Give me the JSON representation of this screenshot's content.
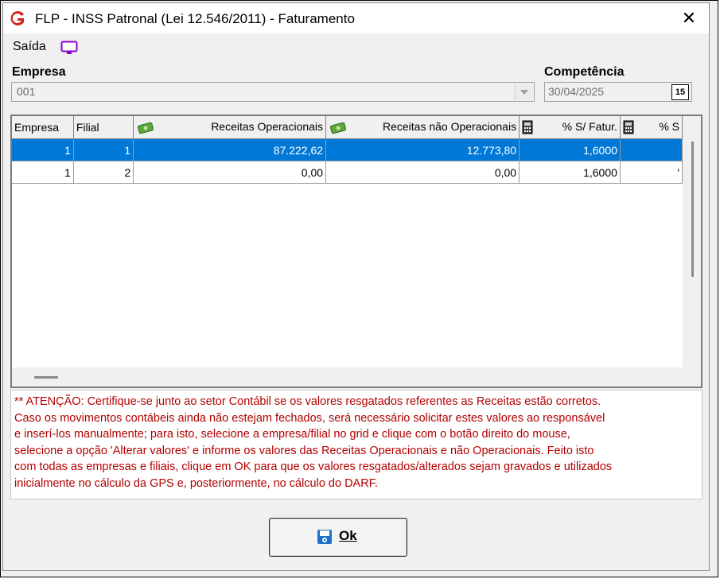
{
  "window": {
    "title": "FLP - INSS Patronal (Lei 12.546/2011) - Faturamento",
    "close_glyph": "✕"
  },
  "menu": {
    "saida_label": "Saída",
    "monitor_icon": "monitor-icon"
  },
  "empresa": {
    "label": "Empresa",
    "value": "001"
  },
  "competencia": {
    "label": "Competência",
    "value": "30/04/2025",
    "calendar_text": "15"
  },
  "grid": {
    "columns": [
      {
        "label": "Empresa",
        "icon": ""
      },
      {
        "label": "Filial",
        "icon": ""
      },
      {
        "label": "Receitas Operacionais",
        "icon": "money-icon"
      },
      {
        "label": "Receitas não Operacionais",
        "icon": "money-icon"
      },
      {
        "label": "% S/ Fatur.",
        "icon": "calculator-icon"
      },
      {
        "label": "% S",
        "icon": "calculator-icon"
      }
    ],
    "rows": [
      {
        "empresa": "1",
        "filial": "1",
        "rec_op": "87.222,62",
        "rec_nao_op": "12.773,80",
        "pct": "1,6000",
        "pct2": "",
        "selected": true
      },
      {
        "empresa": "1",
        "filial": "2",
        "rec_op": "0,00",
        "rec_nao_op": "0,00",
        "pct": "1,6000",
        "pct2": "'",
        "selected": false
      }
    ]
  },
  "note": {
    "lines": [
      "** ATENÇÃO:  Certifique-se junto ao setor Contábil se os valores resgatados referentes as Receitas estão corretos.",
      "Caso os movimentos contábeis ainda não estejam fechados, será necessário solicitar estes valores ao responsável",
      "e inserí-los manualmente; para isto, selecione a empresa/filial no grid e clique com o botão direito do mouse,",
      "selecione a opção 'Alterar valores' e informe os valores das Receitas Operacionais e não Operacionais.  Feito isto",
      "com todas as empresas e filiais, clique em OK para que os valores resgatados/alterados sejam gravados e utilizados",
      "inicialmente no cálculo da GPS e, posteriormente, no cálculo do DARF."
    ]
  },
  "ok_button": {
    "label": "Ok",
    "icon": "save-icon"
  },
  "colors": {
    "selection": "#0078d7",
    "warning_text": "#b30000"
  }
}
